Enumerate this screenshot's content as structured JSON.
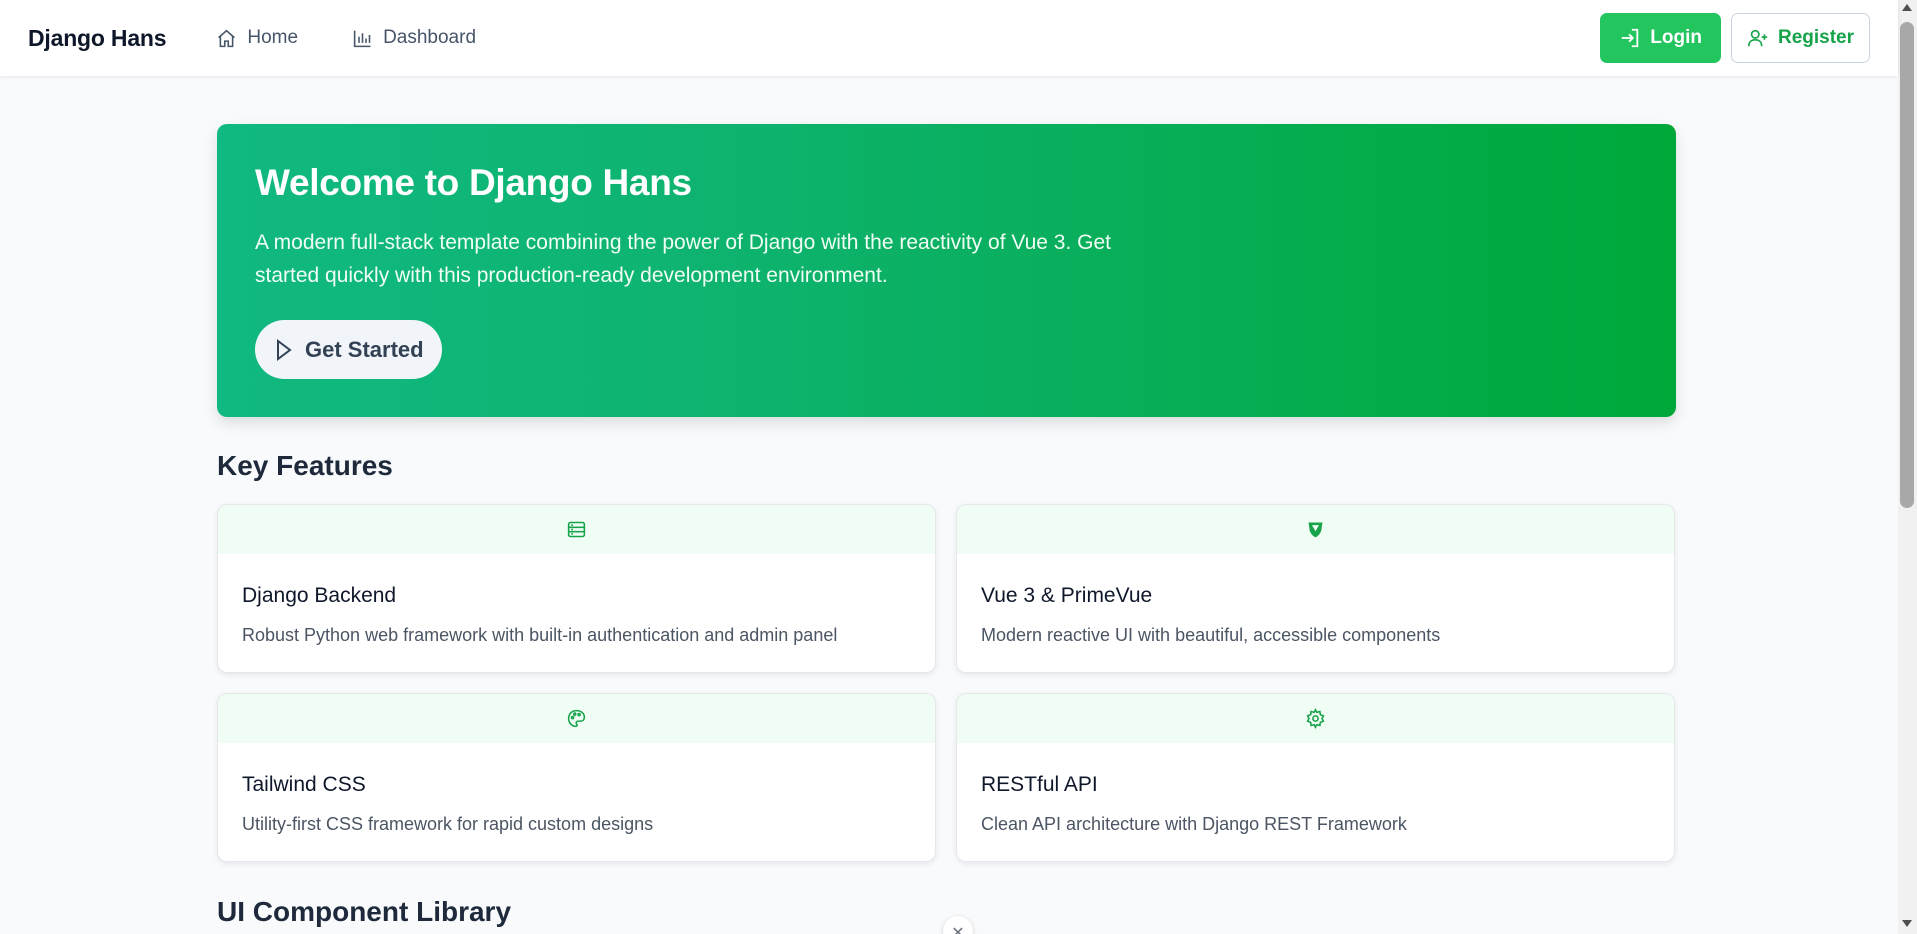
{
  "nav": {
    "brand": "Django Hans",
    "items": [
      {
        "label": "Home",
        "icon": "home-icon"
      },
      {
        "label": "Dashboard",
        "icon": "chart-bar-icon"
      }
    ],
    "login_label": "Login",
    "register_label": "Register"
  },
  "hero": {
    "title": "Welcome to Django Hans",
    "description": "A modern full-stack template combining the power of Django with the reactivity of Vue 3. Get started quickly with this production-ready development environment.",
    "cta_label": "Get Started"
  },
  "features": {
    "title": "Key Features",
    "cards": [
      {
        "title": "Django Backend",
        "description": "Robust Python web framework with built-in authentication and admin panel",
        "icon": "server-icon"
      },
      {
        "title": "Vue 3 & PrimeVue",
        "description": "Modern reactive UI with beautiful, accessible components",
        "icon": "vue-icon"
      },
      {
        "title": "Tailwind CSS",
        "description": "Utility-first CSS framework for rapid custom designs",
        "icon": "palette-icon"
      },
      {
        "title": "RESTful API",
        "description": "Clean API architecture with Django REST Framework",
        "icon": "cog-icon"
      }
    ]
  },
  "components_section": {
    "title": "UI Component Library"
  },
  "colors": {
    "primary": "#22c55e",
    "primary_dark": "#16a34a",
    "hero_start": "#10b981",
    "hero_end": "#00a83a",
    "card_head": "#f0fdf4"
  }
}
